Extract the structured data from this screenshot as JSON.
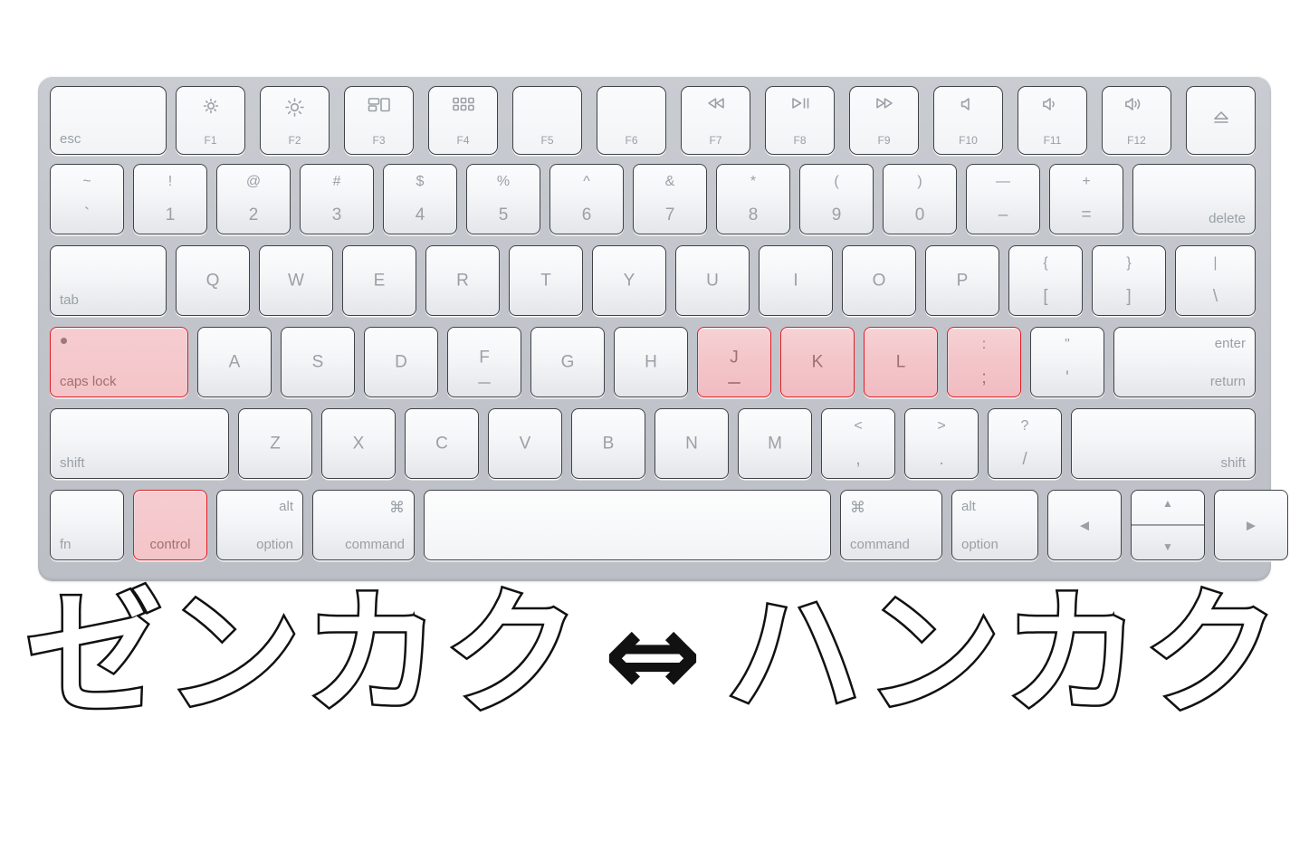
{
  "caption": {
    "left_text": "ゼンカク",
    "arrow": "⇔",
    "right_text": "ハンカク"
  },
  "keyboard": {
    "name": "apple-magic-keyboard",
    "highlight_color": "#f0bcc1",
    "highlight_border_color": "#e01b22",
    "body_color": "#c4c8ce",
    "key_color": "#f6f7f9",
    "legend_color": "#9aa0a6",
    "rows": [
      {
        "name": "function-row",
        "keys": [
          {
            "id": "esc",
            "label": "esc",
            "align": "bottom-left"
          },
          {
            "id": "f1",
            "label": "F1",
            "icon": "brightness-down-icon"
          },
          {
            "id": "f2",
            "label": "F2",
            "icon": "brightness-up-icon"
          },
          {
            "id": "f3",
            "label": "F3",
            "icon": "mission-control-icon"
          },
          {
            "id": "f4",
            "label": "F4",
            "icon": "launchpad-icon"
          },
          {
            "id": "f5",
            "label": "F5",
            "icon": ""
          },
          {
            "id": "f6",
            "label": "F6",
            "icon": ""
          },
          {
            "id": "f7",
            "label": "F7",
            "icon": "rewind-icon"
          },
          {
            "id": "f8",
            "label": "F8",
            "icon": "play-pause-icon"
          },
          {
            "id": "f9",
            "label": "F9",
            "icon": "fast-forward-icon"
          },
          {
            "id": "f10",
            "label": "F10",
            "icon": "mute-icon"
          },
          {
            "id": "f11",
            "label": "F11",
            "icon": "volume-down-icon"
          },
          {
            "id": "f12",
            "label": "F12",
            "icon": "volume-up-icon"
          },
          {
            "id": "eject",
            "label": "",
            "icon": "eject-icon"
          }
        ]
      },
      {
        "name": "number-row",
        "keys": [
          {
            "id": "backtick",
            "top": "~",
            "bottom": "`"
          },
          {
            "id": "1",
            "top": "!",
            "bottom": "1"
          },
          {
            "id": "2",
            "top": "@",
            "bottom": "2"
          },
          {
            "id": "3",
            "top": "#",
            "bottom": "3"
          },
          {
            "id": "4",
            "top": "$",
            "bottom": "4"
          },
          {
            "id": "5",
            "top": "%",
            "bottom": "5"
          },
          {
            "id": "6",
            "top": "^",
            "bottom": "6"
          },
          {
            "id": "7",
            "top": "&",
            "bottom": "7"
          },
          {
            "id": "8",
            "top": "*",
            "bottom": "8"
          },
          {
            "id": "9",
            "top": "(",
            "bottom": "9"
          },
          {
            "id": "0",
            "top": ")",
            "bottom": "0"
          },
          {
            "id": "minus",
            "top": "—",
            "bottom": "–"
          },
          {
            "id": "equal",
            "top": "+",
            "bottom": "="
          },
          {
            "id": "delete",
            "label": "delete",
            "align": "bottom-right"
          }
        ]
      },
      {
        "name": "qwerty-row",
        "keys": [
          {
            "id": "tab",
            "label": "tab",
            "align": "bottom-left"
          },
          {
            "id": "q",
            "label": "Q"
          },
          {
            "id": "w",
            "label": "W"
          },
          {
            "id": "e",
            "label": "E"
          },
          {
            "id": "r",
            "label": "R"
          },
          {
            "id": "t",
            "label": "T"
          },
          {
            "id": "y",
            "label": "Y"
          },
          {
            "id": "u",
            "label": "U"
          },
          {
            "id": "i",
            "label": "I"
          },
          {
            "id": "o",
            "label": "O"
          },
          {
            "id": "p",
            "label": "P"
          },
          {
            "id": "bracketleft",
            "top": "{",
            "bottom": "["
          },
          {
            "id": "bracketright",
            "top": "}",
            "bottom": "]"
          },
          {
            "id": "backslash",
            "top": "|",
            "bottom": "\\"
          }
        ]
      },
      {
        "name": "home-row",
        "keys": [
          {
            "id": "capslock",
            "label": "caps lock",
            "align": "bottom-left",
            "highlighted": true,
            "led": true
          },
          {
            "id": "a",
            "label": "A"
          },
          {
            "id": "s",
            "label": "S"
          },
          {
            "id": "d",
            "label": "D"
          },
          {
            "id": "f",
            "label": "F",
            "bump": true
          },
          {
            "id": "g",
            "label": "G"
          },
          {
            "id": "h",
            "label": "H"
          },
          {
            "id": "j",
            "label": "J",
            "bump": true,
            "highlighted": true
          },
          {
            "id": "k",
            "label": "K",
            "highlighted": true
          },
          {
            "id": "l",
            "label": "L",
            "highlighted": true
          },
          {
            "id": "semicolon",
            "top": ":",
            "bottom": ";",
            "highlighted": true
          },
          {
            "id": "quote",
            "top": "\"",
            "bottom": "'"
          },
          {
            "id": "return",
            "label_top": "enter",
            "label_bottom": "return"
          }
        ]
      },
      {
        "name": "shift-row",
        "keys": [
          {
            "id": "shift-left",
            "label": "shift",
            "align": "bottom-left"
          },
          {
            "id": "z",
            "label": "Z"
          },
          {
            "id": "x",
            "label": "X"
          },
          {
            "id": "c",
            "label": "C"
          },
          {
            "id": "v",
            "label": "V"
          },
          {
            "id": "b",
            "label": "B"
          },
          {
            "id": "n",
            "label": "N"
          },
          {
            "id": "m",
            "label": "M"
          },
          {
            "id": "comma",
            "top": "<",
            "bottom": ","
          },
          {
            "id": "period",
            "top": ">",
            "bottom": "."
          },
          {
            "id": "slash",
            "top": "?",
            "bottom": "/"
          },
          {
            "id": "shift-right",
            "label": "shift",
            "align": "bottom-right"
          }
        ]
      },
      {
        "name": "bottom-row",
        "keys": [
          {
            "id": "fn",
            "label": "fn",
            "align": "bottom-left"
          },
          {
            "id": "control",
            "label": "control",
            "align": "bottom-center",
            "highlighted": true
          },
          {
            "id": "option-left",
            "top": "alt",
            "bottom": "option"
          },
          {
            "id": "command-left",
            "top": "⌘",
            "bottom": "command"
          },
          {
            "id": "space",
            "label": ""
          },
          {
            "id": "command-right",
            "top": "⌘",
            "bottom": "command"
          },
          {
            "id": "option-right",
            "top": "alt",
            "bottom": "option"
          },
          {
            "id": "arrow-left",
            "label": "◀",
            "icon": "arrow-left-icon"
          },
          {
            "id": "arrow-updown",
            "up": "▲",
            "down": "▼",
            "icon": "arrow-up-down-icon"
          },
          {
            "id": "arrow-right",
            "label": "▶",
            "icon": "arrow-right-icon"
          }
        ]
      }
    ]
  }
}
